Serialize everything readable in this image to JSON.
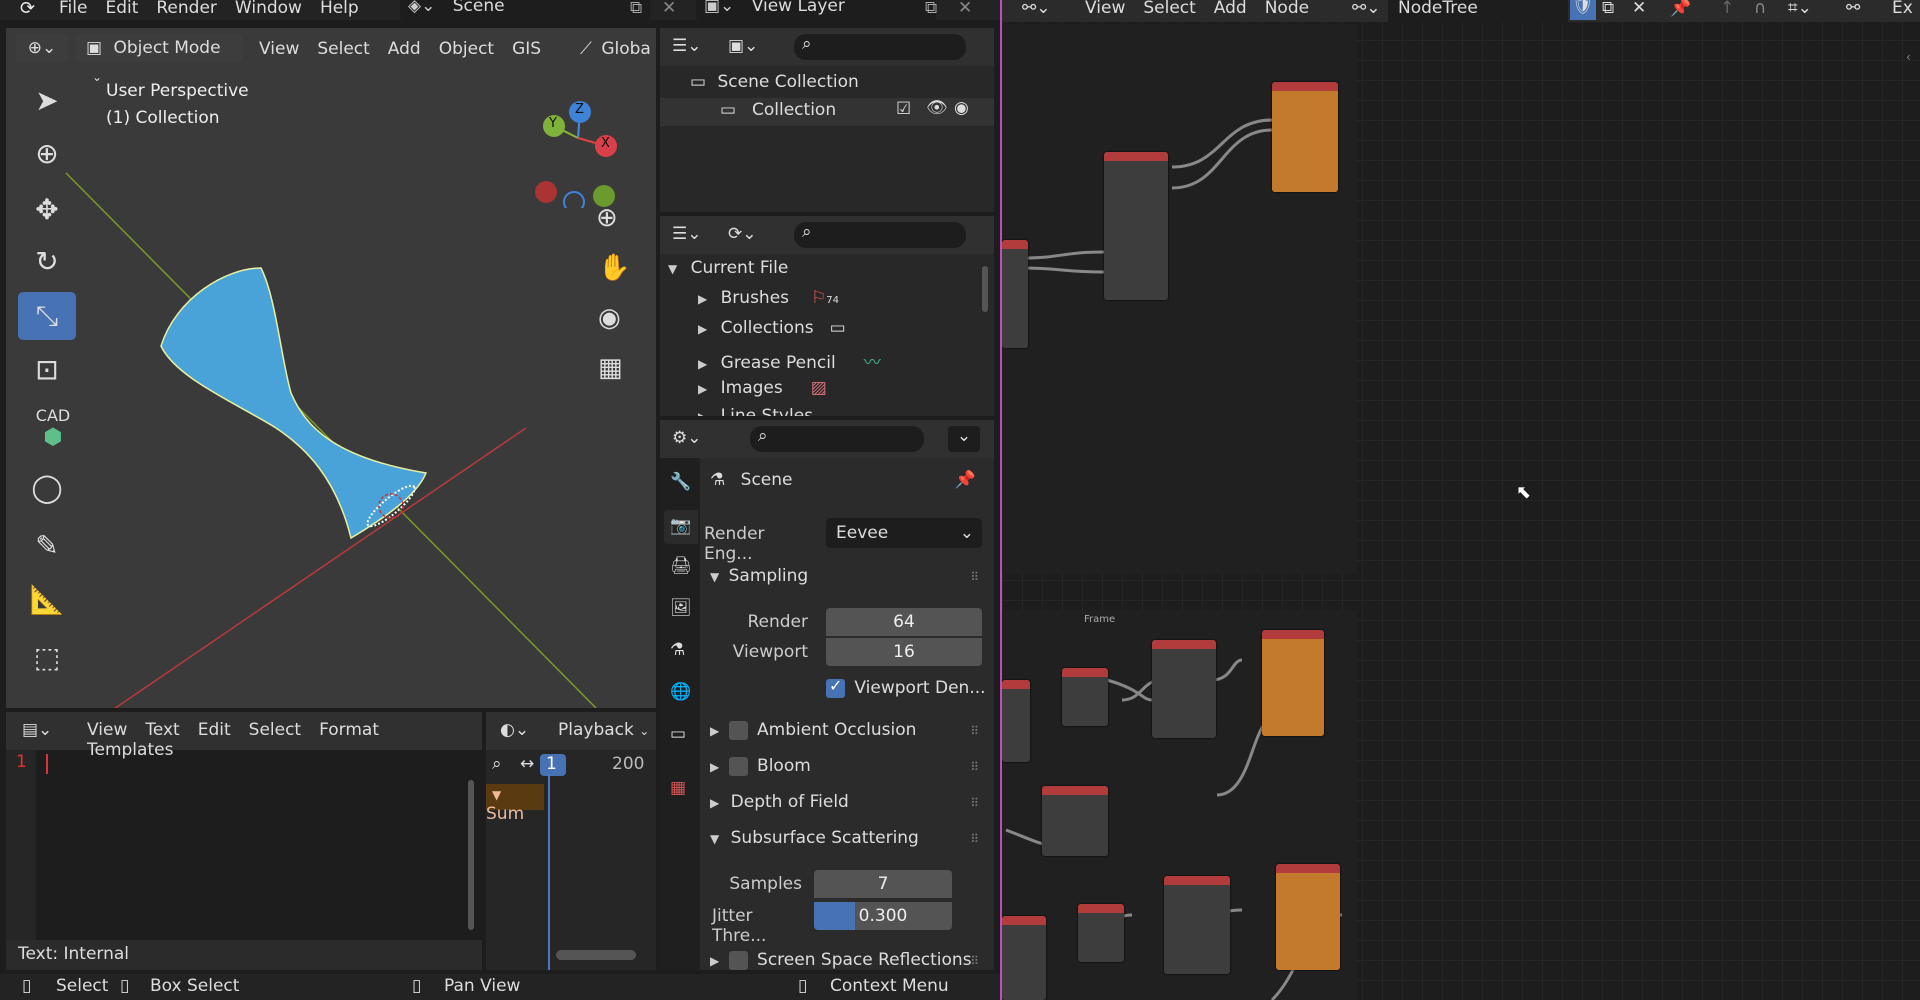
{
  "topbar": {
    "menus": [
      "File",
      "Edit",
      "Render",
      "Window",
      "Help"
    ],
    "scene": "Scene",
    "view_layer": "View Layer"
  },
  "viewport": {
    "mode": "Object Mode",
    "menus": [
      "View",
      "Select",
      "Add",
      "Object",
      "GIS"
    ],
    "transform": "Globa",
    "perspective": "User Perspective",
    "collection": "(1) Collection",
    "cad_label": "CAD",
    "axes": {
      "y": "Y",
      "z": "Z",
      "x": "X"
    }
  },
  "outliner": {
    "scene_collection": "Scene Collection",
    "collection": "Collection"
  },
  "blendfile": {
    "current_file": "Current File",
    "items": [
      "Brushes",
      "Collections",
      "Grease Pencil",
      "Images",
      "Line Styles"
    ],
    "brush_count": "74"
  },
  "properties": {
    "scene": "Scene",
    "render_engine_label": "Render Eng...",
    "render_engine": "Eevee",
    "sampling": "Sampling",
    "render_label": "Render",
    "render_value": "64",
    "viewport_label": "Viewport",
    "viewport_value": "16",
    "denoise": "Viewport Den...",
    "ao": "Ambient Occlusion",
    "bloom": "Bloom",
    "dof": "Depth of Field",
    "sss": "Subsurface Scattering",
    "samples_label": "Samples",
    "samples_value": "7",
    "jitter_label": "Jitter Thre...",
    "jitter_value": "0.300",
    "jitter_fill": 0.3,
    "ssr": "Screen Space Reflections"
  },
  "texteditor": {
    "menus": [
      "View",
      "Text",
      "Edit",
      "Select",
      "Format",
      "Templates"
    ],
    "line": "1",
    "footer": "Text: Internal"
  },
  "timeline": {
    "playback": "Playback",
    "frame": "1",
    "end": "200",
    "summary": "Sum"
  },
  "nodeeditor": {
    "menus": [
      "View",
      "Select",
      "Add",
      "Node"
    ],
    "tree": "NodeTree",
    "ex": "Ex",
    "frame_label": "Frame"
  },
  "statusbar": {
    "select": "Select",
    "box_select": "Box Select",
    "pan": "Pan View",
    "context": "Context Menu"
  },
  "colors": {
    "accent": "#4772b3",
    "node_orange": "#c47a2c",
    "node_red": "#b23c3c"
  }
}
